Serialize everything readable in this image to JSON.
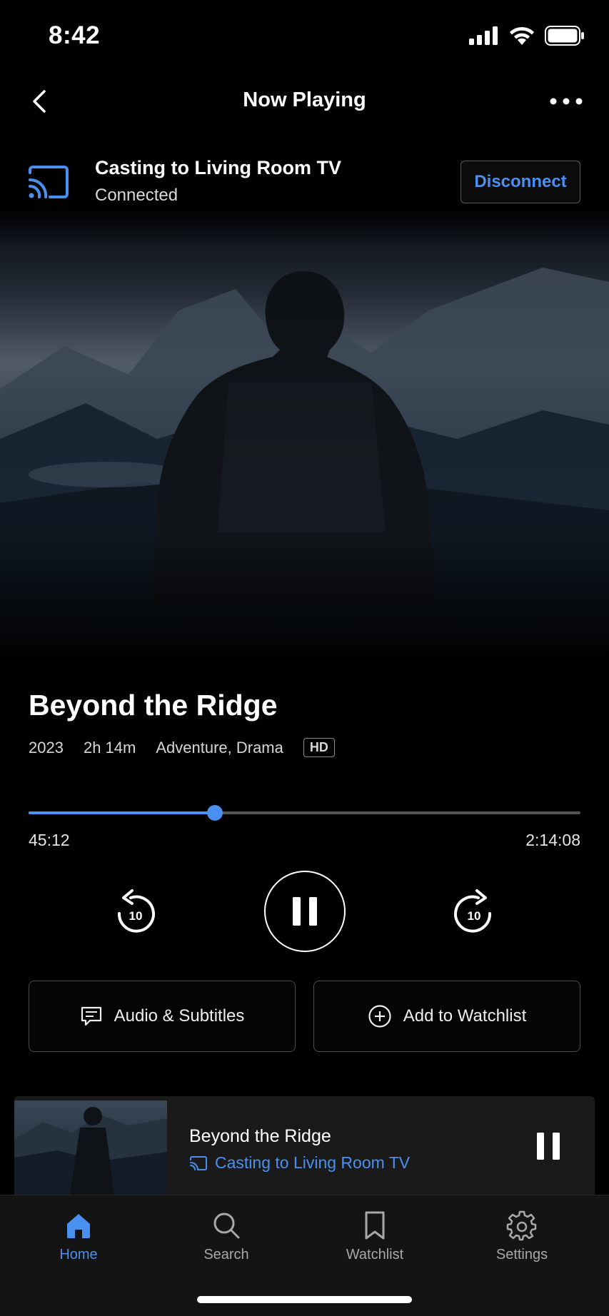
{
  "status_bar": {
    "time": "8:42"
  },
  "nav": {
    "title": "Now Playing"
  },
  "cast": {
    "title": "Casting to Living Room TV",
    "status": "Connected",
    "disconnect_label": "Disconnect"
  },
  "movie": {
    "title": "Beyond the Ridge",
    "year": "2023",
    "duration": "2h 14m",
    "genres": "Adventure, Drama",
    "quality_badge": "HD"
  },
  "playback": {
    "elapsed": "45:12",
    "total": "2:14:08",
    "progress_fraction": 0.337,
    "rewind_seconds": "10",
    "forward_seconds": "10"
  },
  "actions": {
    "audio_subtitles_label": "Audio & Subtitles",
    "add_watchlist_label": "Add to Watchlist"
  },
  "mini_player": {
    "title": "Beyond the Ridge",
    "cast_label": "Casting to Living Room TV"
  },
  "tabs": [
    {
      "label": "Home",
      "icon": "home-icon",
      "active": true
    },
    {
      "label": "Search",
      "icon": "search-icon",
      "active": false
    },
    {
      "label": "Watchlist",
      "icon": "bookmark-icon",
      "active": false
    },
    {
      "label": "Settings",
      "icon": "gear-icon",
      "active": false
    }
  ],
  "colors": {
    "accent": "#4a90f0",
    "background": "#000000",
    "surface": "#1a1a1a"
  }
}
